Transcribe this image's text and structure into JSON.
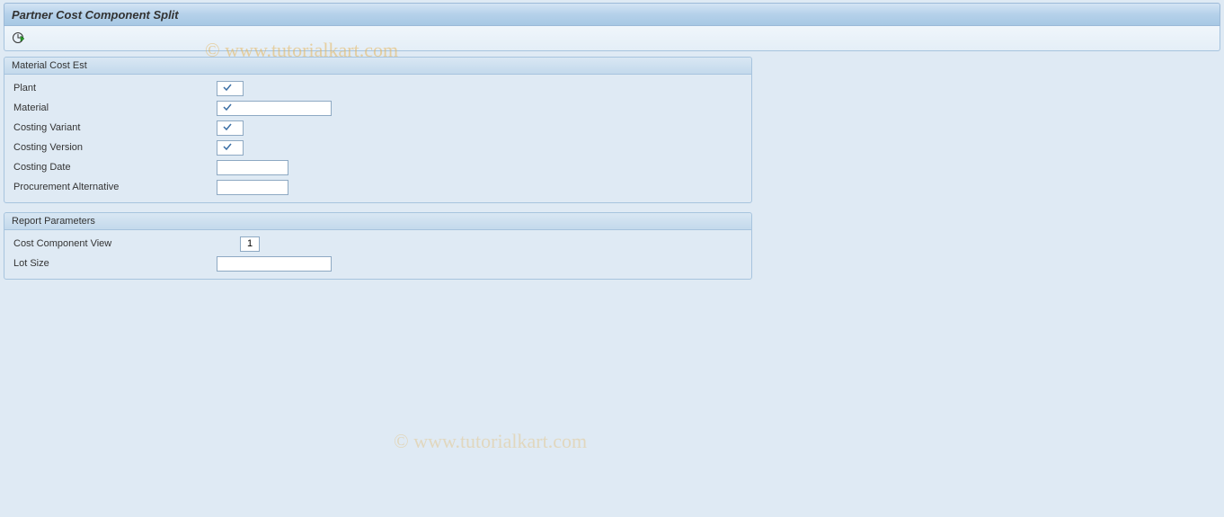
{
  "title": "Partner Cost Component Split",
  "watermark": "© www.tutorialkart.com",
  "group1": {
    "title": "Material Cost Est",
    "fields": {
      "plant": {
        "label": "Plant",
        "value": ""
      },
      "material": {
        "label": "Material",
        "value": ""
      },
      "costing_variant": {
        "label": "Costing Variant",
        "value": ""
      },
      "costing_version": {
        "label": "Costing Version",
        "value": ""
      },
      "costing_date": {
        "label": "Costing Date",
        "value": ""
      },
      "procurement_alt": {
        "label": "Procurement Alternative",
        "value": ""
      }
    }
  },
  "group2": {
    "title": "Report Parameters",
    "fields": {
      "cost_component_view": {
        "label": "Cost Component View",
        "value": "1"
      },
      "lot_size": {
        "label": "Lot Size",
        "value": ""
      }
    }
  }
}
